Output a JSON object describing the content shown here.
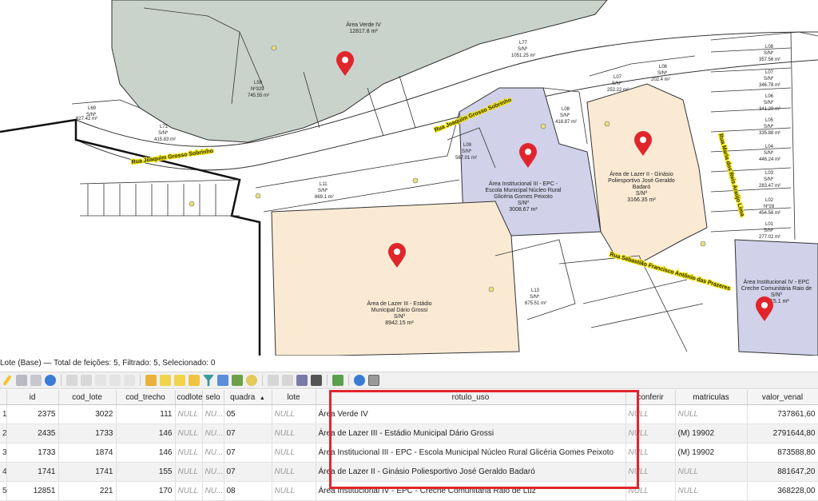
{
  "map": {
    "areas": [
      {
        "name": "Área Verde IV",
        "value": "12817.8 m²"
      },
      {
        "name_lines": [
          "Área Institucional III - EPC -",
          "Escola Municipal Núcleo Rural",
          "Glicéria Gomes Peixoto"
        ],
        "value": "3008.67 m²",
        "sn": "S/Nº"
      },
      {
        "name_lines": [
          "Área de Lazer II - Ginásio",
          "Poliesportivo José Geraldo",
          "Badaró"
        ],
        "value": "3166.35 m²",
        "sn": "S/Nº"
      },
      {
        "name_lines": [
          "Área de Lazer III - Estádio",
          "Municipal Dário Grossi"
        ],
        "value": "8942.15 m²",
        "sn": "S/Nº"
      },
      {
        "name_lines": [
          "Área Institucional IV - EPC",
          "Creche Comunitária Raio de"
        ],
        "value": "1315.1 m²",
        "sn": "S/Nº"
      }
    ],
    "streets": [
      "Rua Joaquim Grosso Sobrinho",
      "Rua Joaquim Grosso Sobrinho",
      "Rua Maria dos Reis Araújo Lima",
      "Rua Sebastião Francisco Antônio das Prazeres"
    ],
    "lots": [
      {
        "label": [
          "L77",
          "S/Nº",
          "1051.25 m²"
        ]
      },
      {
        "label": [
          "L59",
          "Nº329",
          "745.55 m²"
        ]
      },
      {
        "label": [
          "L71",
          "S/Nº",
          "415.83 m²"
        ]
      },
      {
        "label": [
          "L69",
          "S/Nº",
          "627.42 m²"
        ]
      },
      {
        "label": [
          "L11",
          "S/Nº",
          "869.1 m²"
        ]
      },
      {
        "label": [
          "L09",
          "S/Nº",
          "567.01 m²"
        ]
      },
      {
        "label": [
          "L08",
          "S/Nº",
          "418.87 m²"
        ]
      },
      {
        "label": [
          "L07",
          "S/Nº",
          "252.22 m²"
        ]
      },
      {
        "label": [
          "L06",
          "S/Nº",
          "202.4 m²"
        ]
      },
      {
        "label": [
          "L05",
          "S/Nº",
          "131.1 m²"
        ]
      },
      {
        "label": [
          "L08",
          "S/Nº",
          "357.56 m²"
        ]
      },
      {
        "label": [
          "L07",
          "S/Nº",
          "346.78 m²"
        ]
      },
      {
        "label": [
          "L06",
          "S/Nº",
          "341.29 m²"
        ]
      },
      {
        "label": [
          "L05",
          "S/Nº",
          "335.88 m²"
        ]
      },
      {
        "label": [
          "L04",
          "S/Nº",
          "446.24 m²"
        ]
      },
      {
        "label": [
          "L03",
          "S/Nº",
          "283.47 m²"
        ]
      },
      {
        "label": [
          "L02",
          "Nº28",
          "454.56 m²"
        ]
      },
      {
        "label": [
          "L01",
          "S/Nº",
          "277.02 m²"
        ]
      },
      {
        "label": [
          "L13",
          "S/Nº",
          "675.51 m²"
        ]
      },
      {
        "label": [
          "L11",
          "S/Nº",
          "428.49 m²"
        ]
      },
      {
        "label": [
          "L01",
          "S/Nº",
          "279.92 m²"
        ]
      }
    ]
  },
  "attribute_table": {
    "title": "Lote (Base) — Total de feições: 5, Filtrado: 5, Selecionado: 0",
    "columns": [
      "id",
      "cod_lote",
      "cod_trecho",
      "codlote",
      "selo",
      "quadra",
      "lote",
      "rotulo_uso",
      "conferir",
      "matriculas",
      "valor_venal"
    ],
    "row_numbers": [
      "1",
      "2",
      "3",
      "4",
      "5"
    ],
    "null_text": "NULL",
    "null_short": "NU...",
    "rows": [
      {
        "id": "2375",
        "cod_lote": "3022",
        "cod_trecho": "111",
        "quadra": "05",
        "rotulo_uso": "Área Verde IV",
        "matriculas": "NULL",
        "valor_venal": "737861,60"
      },
      {
        "id": "2435",
        "cod_lote": "1733",
        "cod_trecho": "146",
        "quadra": "07",
        "rotulo_uso": "Área de Lazer III - Estádio Municipal Dário Grossi",
        "matriculas": "(M) 19902",
        "valor_venal": "2791644,80"
      },
      {
        "id": "1733",
        "cod_lote": "1874",
        "cod_trecho": "146",
        "quadra": "07",
        "rotulo_uso": "Área Institucional III - EPC - Escola Municipal Núcleo Rural Glicéria Gomes Peixoto",
        "matriculas": "(M) 19902",
        "valor_venal": "873588,80"
      },
      {
        "id": "1741",
        "cod_lote": "1741",
        "cod_trecho": "155",
        "quadra": "07",
        "rotulo_uso": "Área de Lazer II - Ginásio Poliesportivo José Geraldo Badaró",
        "matriculas": "NULL",
        "valor_venal": "881647,20"
      },
      {
        "id": "12851",
        "cod_lote": "221",
        "cod_trecho": "170",
        "quadra": "08",
        "rotulo_uso": "Área Institucional IV - EPC - Creche Comunitária Raio de Luz",
        "matriculas": "NULL",
        "valor_venal": "368228,00"
      }
    ],
    "sort_indicator": "▲"
  },
  "colors": {
    "green_area": "#c9d3cb",
    "institutional": "#d1d1ea",
    "leisure": "#faead4",
    "marker": "#e0262c",
    "highlight": "#e0262c",
    "street_label": "#f0e41b"
  },
  "icons": [
    "pencil-icon",
    "save-icon",
    "refresh-icon",
    "delete-icon",
    "filter-icon",
    "zoom-icon",
    "table-icon"
  ]
}
